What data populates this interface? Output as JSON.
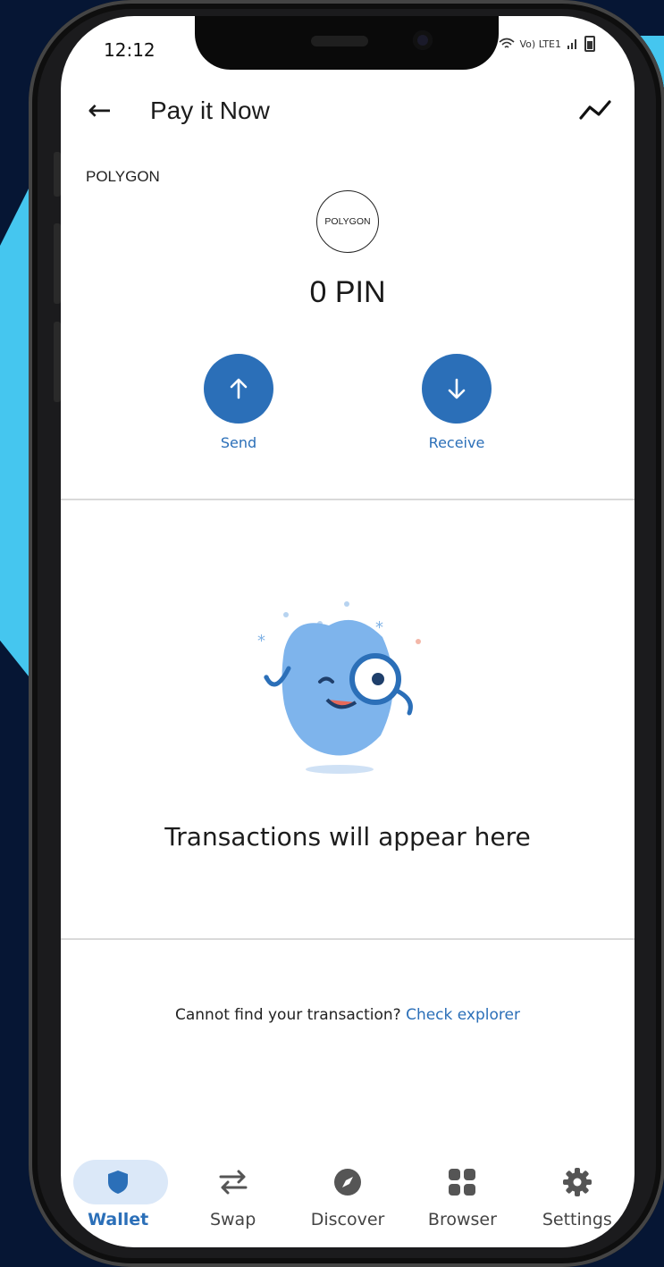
{
  "status_bar": {
    "time": "12:12",
    "network_label": "Vo) LTE1"
  },
  "appbar": {
    "title": "Pay it Now"
  },
  "asset": {
    "network": "POLYGON",
    "logo_text": "POLYGON",
    "balance": "0 PIN"
  },
  "actions": [
    {
      "label": "Send"
    },
    {
      "label": "Receive"
    }
  ],
  "empty_state": {
    "message": "Transactions will appear here"
  },
  "footer": {
    "prompt": "Cannot find your transaction?",
    "link": "Check explorer"
  },
  "nav": {
    "items": [
      {
        "label": "Wallet",
        "icon": "shield-icon",
        "active": true
      },
      {
        "label": "Swap",
        "icon": "swap-icon"
      },
      {
        "label": "Discover",
        "icon": "compass-icon"
      },
      {
        "label": "Browser",
        "icon": "apps-grid-icon"
      },
      {
        "label": "Settings",
        "icon": "gear-icon"
      }
    ]
  },
  "colors": {
    "accent": "#2b6fb8",
    "background": "#061634",
    "decor": "#45c6ef"
  }
}
